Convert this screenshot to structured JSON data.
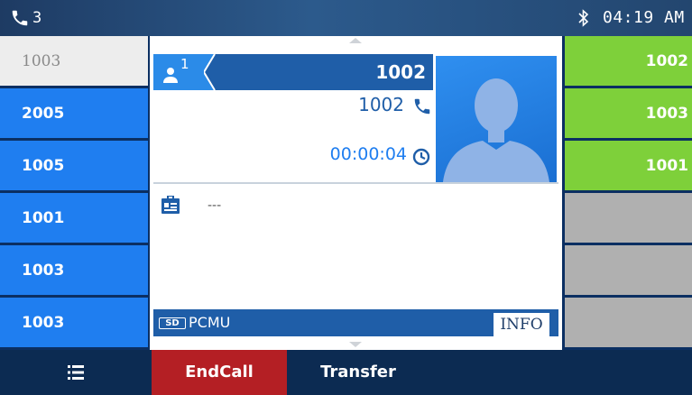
{
  "status": {
    "active_calls": "3",
    "clock": "04:19 AM",
    "icons": [
      "phone-icon",
      "bluetooth-icon"
    ]
  },
  "left_lines": [
    {
      "label": "1003",
      "state": "active"
    },
    {
      "label": "2005",
      "state": "idle"
    },
    {
      "label": "1005",
      "state": "idle"
    },
    {
      "label": "1001",
      "state": "idle"
    },
    {
      "label": "1003",
      "state": "idle"
    },
    {
      "label": "1003",
      "state": "idle"
    }
  ],
  "call": {
    "line_index": "1",
    "name": "1002",
    "number": "1002",
    "duration": "00:00:04",
    "contact_info": "---",
    "codec_badge": "SD",
    "codec": "PCMU",
    "info_label": "INFO"
  },
  "right_keys": [
    {
      "label": "1002",
      "state": "green"
    },
    {
      "label": "1003",
      "state": "green"
    },
    {
      "label": "1001",
      "state": "green"
    },
    {
      "label": "",
      "state": "empty"
    },
    {
      "label": "",
      "state": "empty"
    },
    {
      "label": "",
      "state": "empty"
    }
  ],
  "softkeys": {
    "endcall": "EndCall",
    "transfer": "Transfer"
  },
  "colors": {
    "line_blue": "#1f7ef0",
    "header_blue": "#1f5ea8",
    "bl_green": "#7ed03a",
    "endcall_red": "#b41f24",
    "empty_gray": "#b0b0b0"
  }
}
